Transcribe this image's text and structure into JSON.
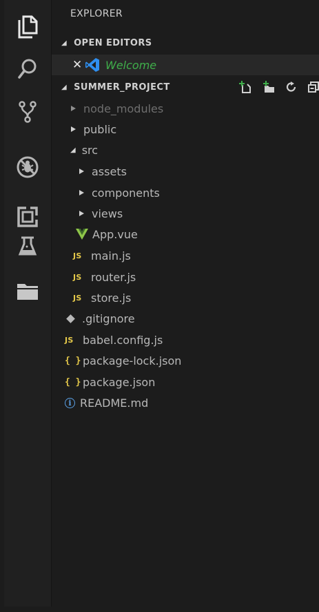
{
  "explorer": {
    "title": "EXPLORER"
  },
  "activity_bar": {
    "icons": [
      "files-icon",
      "search-icon",
      "source-control-icon",
      "debug-icon",
      "extensions-icon",
      "test-flask-icon",
      "folder-icon"
    ]
  },
  "open_editors": {
    "header": "OPEN EDITORS",
    "items": [
      {
        "label": "Welcome"
      }
    ]
  },
  "project": {
    "header": "SUMMER_PROJECT",
    "tree": [
      {
        "label": "node_modules"
      },
      {
        "label": "public"
      },
      {
        "label": "src"
      },
      {
        "label": "assets"
      },
      {
        "label": "components"
      },
      {
        "label": "views"
      },
      {
        "label": "App.vue"
      },
      {
        "label": "main.js"
      },
      {
        "label": "router.js"
      },
      {
        "label": "store.js"
      },
      {
        "label": ".gitignore"
      },
      {
        "label": "babel.config.js"
      },
      {
        "label": "package-lock.json"
      },
      {
        "label": "package.json"
      },
      {
        "label": "README.md"
      }
    ]
  },
  "icon_text": {
    "js": "JS",
    "json": "{ }",
    "info": "i"
  },
  "colors": {
    "accent_green": "#3fae4a",
    "vscode_blue": "#2f8ff0",
    "js_yellow": "#e5c94a",
    "vue_green": "#8ec549"
  }
}
